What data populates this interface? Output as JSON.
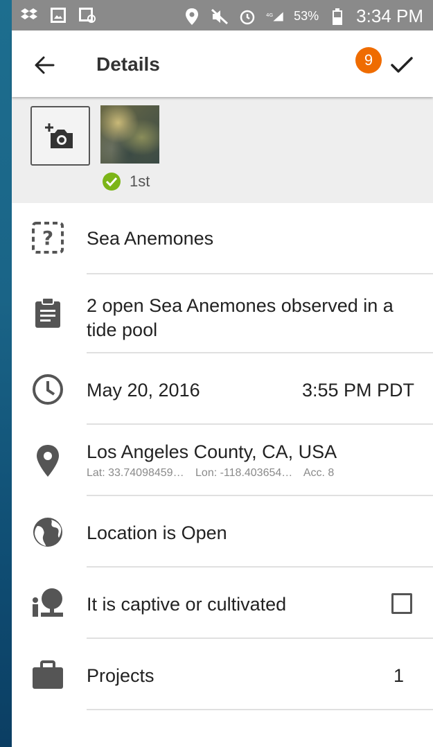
{
  "status_bar": {
    "battery_percent": "53%",
    "time": "3:34 PM"
  },
  "app_bar": {
    "title": "Details",
    "badge_count": "9"
  },
  "photos": {
    "first_label": "1st"
  },
  "species": {
    "name": "Sea Anemones"
  },
  "notes": {
    "text": "2 open Sea Anemones observed in a tide pool"
  },
  "date_time": {
    "date": "May 20, 2016",
    "time": "3:55 PM PDT"
  },
  "location": {
    "place": "Los Angeles County, CA, USA",
    "lat": "Lat: 33.74098459…",
    "lon": "Lon: -118.403654…",
    "acc": "Acc. 8"
  },
  "geoprivacy": {
    "label": "Location is Open"
  },
  "captive": {
    "label": "It is captive or cultivated",
    "checked": false
  },
  "projects": {
    "label": "Projects",
    "count": "1"
  },
  "colors": {
    "badge": "#ef6c00",
    "check_green": "#7cb518",
    "icon_gray": "#555555"
  }
}
